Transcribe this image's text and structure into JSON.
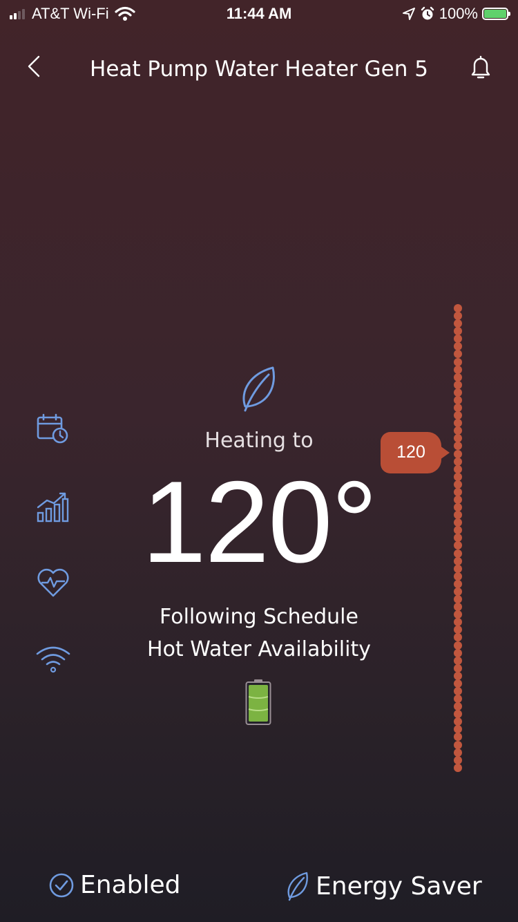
{
  "status_bar": {
    "carrier": "AT&T Wi-Fi",
    "time": "11:44 AM",
    "battery_percent": "100%"
  },
  "header": {
    "title": "Heat Pump Water Heater Gen 5"
  },
  "main": {
    "heating_label": "Heating to",
    "temperature": "120°",
    "mode_text": "Following Schedule",
    "availability_text": "Hot Water Availability",
    "hot_water_level": 1.0,
    "setpoint_tag": "120",
    "setpoint_level": 0.68
  },
  "side_icons": [
    "schedule-icon",
    "usage-chart-icon",
    "health-icon",
    "wifi-icon"
  ],
  "footer": {
    "enabled_label": "Enabled",
    "mode_label": "Energy Saver"
  },
  "colors": {
    "accent_blue": "#6f9be0",
    "setpoint_orange": "#b94e36",
    "battery_green": "#7cb342"
  }
}
